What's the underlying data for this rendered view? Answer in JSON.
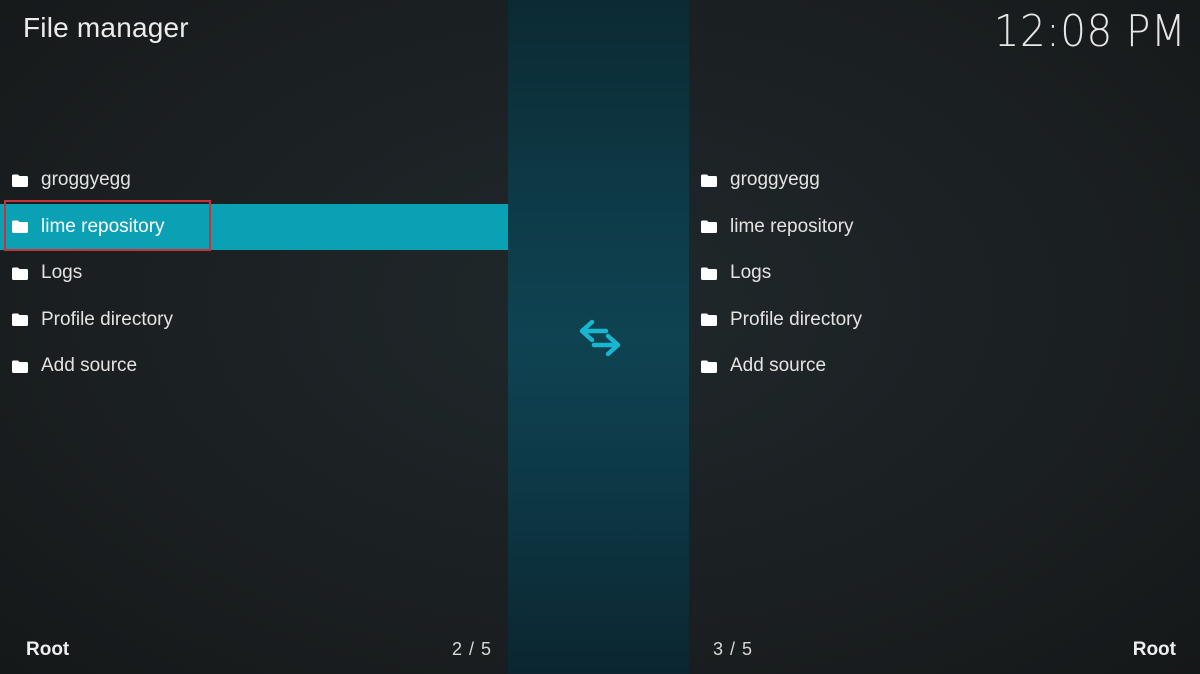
{
  "header": {
    "title": "File manager",
    "clock": "12:08 PM"
  },
  "left_pane": {
    "items": [
      {
        "label": "groggyegg",
        "icon": "folder-icon"
      },
      {
        "label": "lime repository",
        "icon": "folder-icon",
        "selected": true
      },
      {
        "label": "Logs",
        "icon": "folder-icon"
      },
      {
        "label": "Profile directory",
        "icon": "folder-icon"
      },
      {
        "label": "Add source",
        "icon": "folder-icon"
      }
    ],
    "footer_path": "Root",
    "footer_count": "2 / 5"
  },
  "right_pane": {
    "items": [
      {
        "label": "groggyegg",
        "icon": "folder-icon"
      },
      {
        "label": "lime repository",
        "icon": "folder-icon"
      },
      {
        "label": "Logs",
        "icon": "folder-icon"
      },
      {
        "label": "Profile directory",
        "icon": "folder-icon"
      },
      {
        "label": "Add source",
        "icon": "folder-icon"
      }
    ],
    "footer_path": "Root",
    "footer_count": "3 / 5"
  },
  "center": {
    "icon": "swap-arrows-icon"
  },
  "colors": {
    "accent": "#0ba1b5",
    "highlight_border": "#c8323a",
    "center_strip": "#0f4352"
  }
}
